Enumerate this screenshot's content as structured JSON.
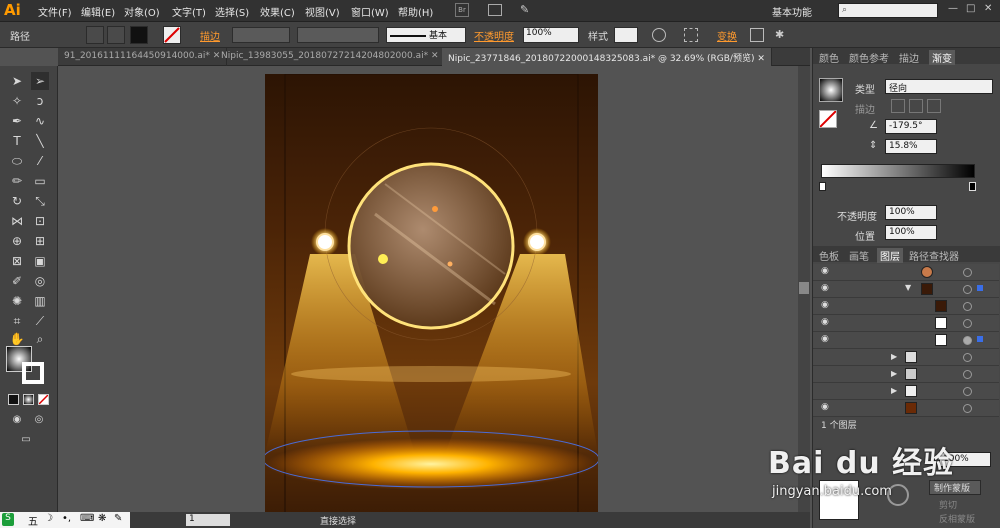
{
  "app": {
    "logo": "Ai"
  },
  "menu": [
    "文件(F)",
    "编辑(E)",
    "对象(O)",
    "文字(T)",
    "选择(S)",
    "效果(C)",
    "视图(V)",
    "窗口(W)",
    "帮助(H)"
  ],
  "workspace": "基本功能",
  "control": {
    "path_label": "路径",
    "stroke_label": "描边",
    "stroke_profile": "基本",
    "opacity_label": "不透明度",
    "opacity_value": "100%",
    "style_label": "样式",
    "transform_label": "变换"
  },
  "tabs": [
    "91_20161111164450914000.ai*",
    "Nipic_13983055_20180727214204802000.ai*",
    "Nipic_23771846_20180722000148325083.ai* @ 32.69% (RGB/预览)"
  ],
  "gradient_panel": {
    "tabs": [
      "颜色",
      "颜色参考",
      "描边",
      "渐变"
    ],
    "type_label": "类型",
    "type_value": "径向",
    "stroke_label": "描边",
    "angle": "-179.5°",
    "aspect": "15.8%",
    "opacity_label": "不透明度",
    "opacity_value": "100%",
    "location_label": "位置",
    "location_value": "100%"
  },
  "layers_panel": {
    "tabs": [
      "色板",
      "画笔",
      "图层",
      "路径查找器"
    ],
    "footer": "1 个图层"
  },
  "transparency_panel": {
    "opacity_value": "100%",
    "make_mask": "制作蒙版",
    "clip": "剪切",
    "invert_mask": "反相蒙版"
  },
  "status": {
    "zoom_page": "1",
    "tool_name": "直接选择"
  },
  "taskbar": {
    "ime": "五"
  },
  "watermark": {
    "brand": "Bai du 经验",
    "url": "jingyan.baidu.com"
  },
  "colors": {
    "accent": "#ff9a2e",
    "stage_glow": "#ffb300",
    "panel_bg": "#474747"
  }
}
